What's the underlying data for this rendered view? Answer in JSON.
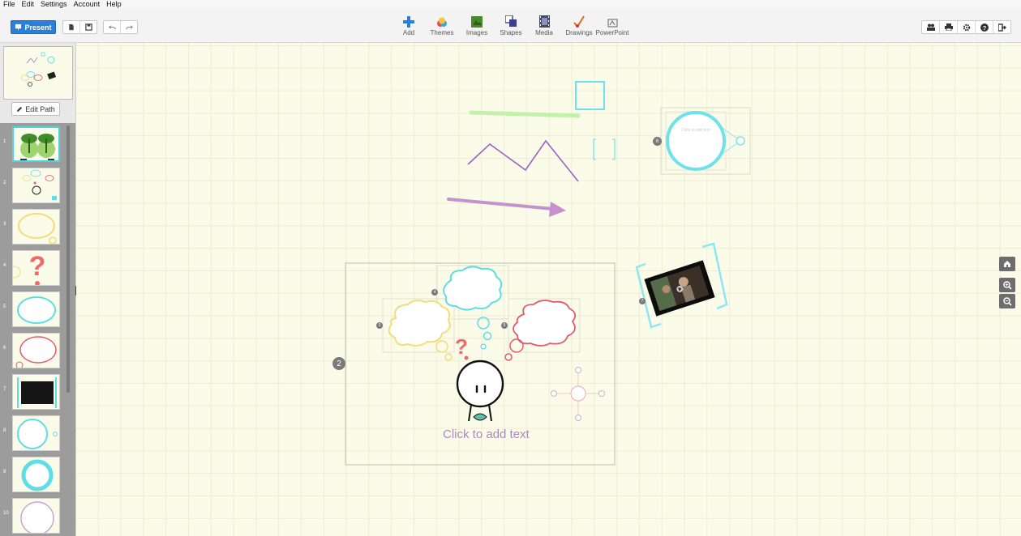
{
  "menu": [
    "File",
    "Edit",
    "Settings",
    "Account",
    "Help"
  ],
  "toolbar": {
    "present_label": "Present",
    "tools": [
      {
        "label": "Add",
        "icon": "plus-icon"
      },
      {
        "label": "Themes",
        "icon": "themes-icon"
      },
      {
        "label": "Images",
        "icon": "images-icon"
      },
      {
        "label": "Shapes",
        "icon": "shapes-icon"
      },
      {
        "label": "Media",
        "icon": "media-icon"
      },
      {
        "label": "Drawings",
        "icon": "drawings-icon"
      },
      {
        "label": "PowerPoint",
        "icon": "powerpoint-icon"
      }
    ],
    "right_icons": [
      "collaborate-icon",
      "print-icon",
      "settings-icon",
      "help-icon",
      "exit-icon"
    ]
  },
  "sidebar": {
    "edit_path_label": "Edit Path",
    "slides": [
      "1",
      "2",
      "3",
      "4",
      "5",
      "6",
      "7",
      "8",
      "9",
      "10"
    ]
  },
  "canvas": {
    "frame_number": "2",
    "click_to_add_text": "Click to add text",
    "circle_placeholder": "Click to add text",
    "small_badges": [
      "6",
      "3",
      "4",
      "5",
      "7"
    ]
  },
  "colors": {
    "accent": "#2b7fd8",
    "cyan": "#5fdde6",
    "purple": "#a88bb8",
    "red": "#e25a6d",
    "yellow": "#f3dc7a",
    "green": "#b9f0a5"
  }
}
